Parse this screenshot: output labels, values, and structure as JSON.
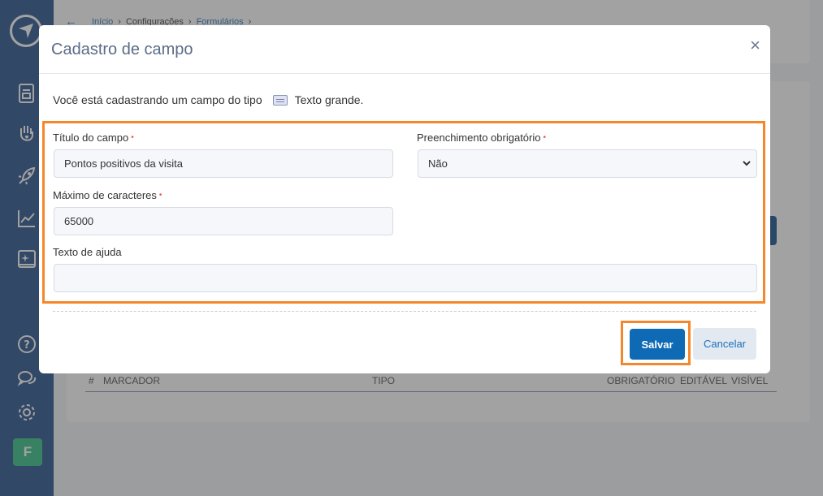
{
  "breadcrumb": {
    "items": [
      "Início",
      "Configurações",
      "Formulários"
    ]
  },
  "background_table": {
    "headers": [
      "#",
      "MARCADOR",
      "TIPO",
      "OBRIGATÓRIO",
      "EDITÁVEL",
      "VISÍVEL"
    ]
  },
  "sidebar": {
    "icons": [
      "document-icon",
      "hand-heart-icon",
      "rocket-icon",
      "chart-icon",
      "sparkle-board-icon",
      "help-icon",
      "chat-icon",
      "gear-icon"
    ],
    "avatar_letter": "F"
  },
  "modal": {
    "title": "Cadastro de campo",
    "close": "×",
    "intro_text": "Você está cadastrando um campo do tipo",
    "field_type": "Texto grande.",
    "fields": {
      "title": {
        "label": "Título do campo",
        "required_mark": "•",
        "value": "Pontos positivos da visita"
      },
      "required": {
        "label": "Preenchimento obrigatório",
        "required_mark": "•",
        "value": "Não"
      },
      "max_chars": {
        "label": "Máximo de caracteres",
        "required_mark": "•",
        "value": "65000"
      },
      "help_text": {
        "label": "Texto de ajuda",
        "value": ""
      }
    },
    "buttons": {
      "save": "Salvar",
      "cancel": "Cancelar"
    }
  },
  "colors": {
    "sidebar": "#1e4a88",
    "accent": "#0f6ab5",
    "highlight": "#f5872a",
    "avatar": "#2bbd7e"
  }
}
